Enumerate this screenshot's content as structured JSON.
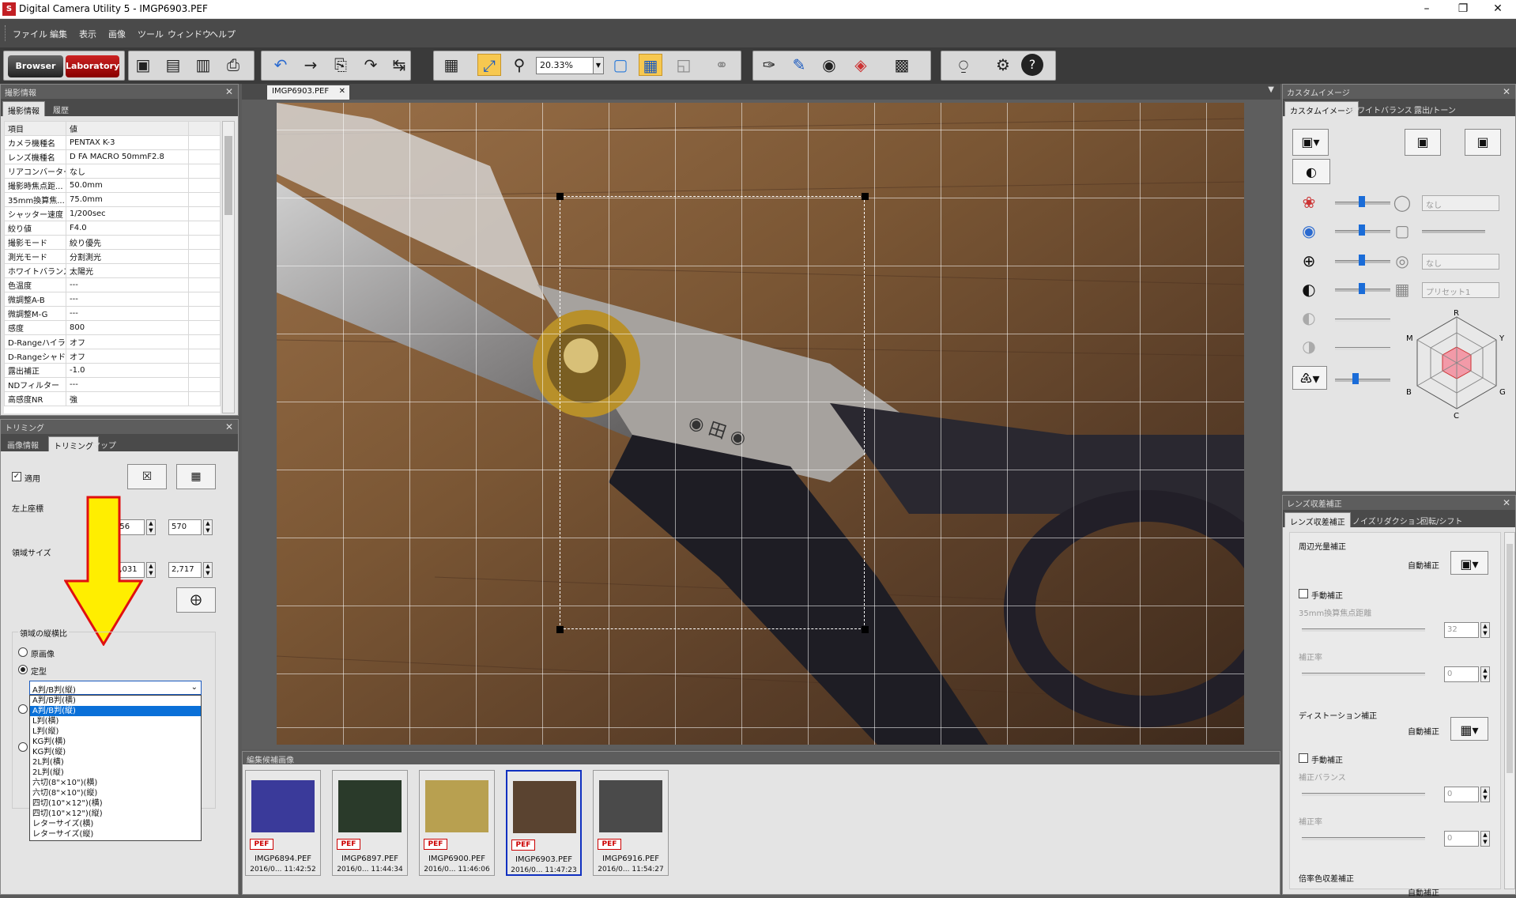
{
  "window": {
    "title": "Digital Camera Utility 5 - IMGP6903.PEF",
    "logo": "S"
  },
  "menu": [
    "ファイル",
    "編集",
    "表示",
    "画像",
    "ツール",
    "ウィンドウ",
    "ヘルプ"
  ],
  "toolbar": {
    "browser_label": "Browser",
    "laboratory_label": "Laboratory",
    "zoom_value": "20.33%"
  },
  "shooting_panel": {
    "title": "撮影情報",
    "tabs": [
      "撮影情報",
      "履歴"
    ],
    "columns": [
      "項目",
      "値"
    ],
    "rows": [
      [
        "カメラ機種名",
        "PENTAX K-3"
      ],
      [
        "レンズ機種名",
        "D FA MACRO 50mmF2.8"
      ],
      [
        "リアコンバーター",
        "なし"
      ],
      [
        "撮影時焦点距...",
        "50.0mm"
      ],
      [
        "35mm換算焦...",
        "75.0mm"
      ],
      [
        "シャッター速度",
        "1/200sec"
      ],
      [
        "絞り値",
        "F4.0"
      ],
      [
        "撮影モード",
        "絞り優先"
      ],
      [
        "測光モード",
        "分割測光"
      ],
      [
        "ホワイトバランス",
        "太陽光"
      ],
      [
        "色温度",
        "---"
      ],
      [
        "微調整A-B",
        "---"
      ],
      [
        "微調整M-G",
        "---"
      ],
      [
        "感度",
        "800"
      ],
      [
        "D-Rangeハイラ...",
        "オフ"
      ],
      [
        "D-Rangeシャド...",
        "オフ"
      ],
      [
        "露出補正",
        "-1.0"
      ],
      [
        "NDフィルター",
        "---"
      ],
      [
        "高感度NR",
        "強"
      ]
    ]
  },
  "trim_panel": {
    "title": "トリミング",
    "tabs": [
      "画像情報",
      "トリミング",
      "マップ"
    ],
    "apply_label": "適用",
    "top_left_label": "左上座標",
    "top_left_x": "756",
    "top_left_y": "570",
    "size_label": "領域サイズ",
    "size_w": "2,031",
    "size_h": "2,717",
    "aspect_group_label": "領域の縦横比",
    "radio_original": "原画像",
    "radio_fixed": "定型",
    "dropdown_value": "A判/B判(縦)",
    "dropdown_options": [
      "A判/B判(横)",
      "A判/B判(縦)",
      "L判(横)",
      "L判(縦)",
      "KG判(横)",
      "KG判(縦)",
      "2L判(横)",
      "2L判(縦)",
      "六切(8\"×10\")(横)",
      "六切(8\"×10\")(縦)",
      "四切(10\"×12\")(横)",
      "四切(10\"×12\")(縦)",
      "レターサイズ(横)",
      "レターサイズ(縦)"
    ],
    "dropdown_selected_index": 1
  },
  "doc_tab": {
    "label": "IMGP6903.PEF"
  },
  "filmstrip": {
    "title": "編集候補画像",
    "items": [
      {
        "name": "IMGP6894.PEF",
        "date": "2016/0... 11:42:52",
        "badge": "PEF",
        "color": "#3a3a9a"
      },
      {
        "name": "IMGP6897.PEF",
        "date": "2016/0... 11:44:34",
        "badge": "PEF",
        "color": "#2a3a2a"
      },
      {
        "name": "IMGP6900.PEF",
        "date": "2016/0... 11:46:06",
        "badge": "PEF",
        "color": "#b8a050"
      },
      {
        "name": "IMGP6903.PEF",
        "date": "2016/0... 11:47:23",
        "badge": "PEF",
        "color": "#5a4330"
      },
      {
        "name": "IMGP6916.PEF",
        "date": "2016/0... 11:54:27",
        "badge": "PEF",
        "color": "#4a4a4a"
      }
    ]
  },
  "custom_image_panel": {
    "title": "カスタムイメージ",
    "tabs": [
      "カスタムイメージ",
      "ホワイトバランス",
      "露出/トーン"
    ],
    "select_none_1": "なし",
    "select_none_2": "なし",
    "select_preset": "プリセット1",
    "hex_labels": {
      "R": "R",
      "Y": "Y",
      "G": "G",
      "C": "C",
      "B": "B",
      "M": "M"
    }
  },
  "lens_panel": {
    "title": "レンズ収差補正",
    "tabs": [
      "レンズ収差補正",
      "ノイズリダクション",
      "回転/シフト"
    ],
    "peripheral_label": "周辺光量補正",
    "auto_label": "自動補正",
    "manual_label": "手動補正",
    "focal_label": "35mm換算焦点距離",
    "focal_value": "32",
    "rate_label": "補正率",
    "rate_value": "0",
    "distortion_label": "ディストーション補正",
    "auto_label2": "自動補正",
    "manual_label2": "手動補正",
    "balance_label": "補正バランス",
    "balance_value": "0",
    "rate_label2": "補正率",
    "rate_value2": "0",
    "chromatic_label": "倍率色収差補正",
    "auto_label3": "自動補正"
  }
}
